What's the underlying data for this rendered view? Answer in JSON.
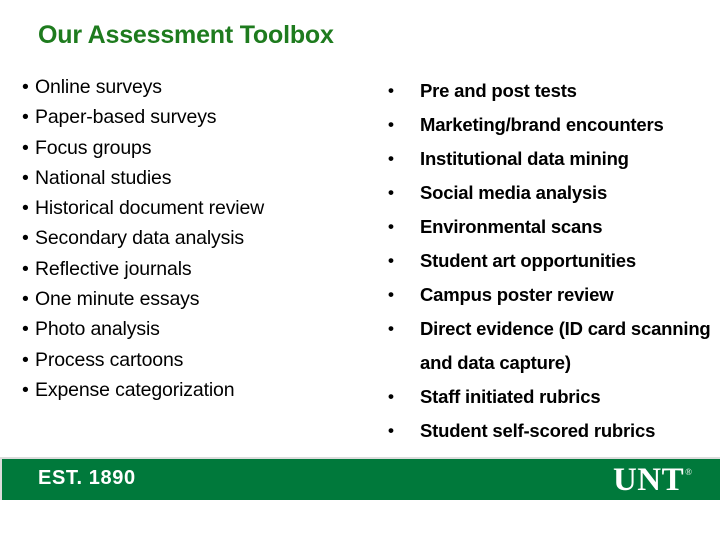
{
  "slide": {
    "title": "Our Assessment Toolbox",
    "title_color": "#1e7b1e",
    "background_color": "#ffffff"
  },
  "left_column": {
    "bullet_char": "•",
    "items": [
      {
        "label": "Online surveys"
      },
      {
        "label": "Paper-based surveys"
      },
      {
        "label": "Focus groups"
      },
      {
        "label": "National studies"
      },
      {
        "label": "Historical document review"
      },
      {
        "label": "Secondary data analysis"
      },
      {
        "label": "Reflective journals"
      },
      {
        "label": "One minute essays"
      },
      {
        "label": "Photo analysis"
      },
      {
        "label": "Process cartoons"
      },
      {
        "label": "Expense categorization"
      }
    ]
  },
  "right_column": {
    "bullet_char": "•",
    "items": [
      {
        "label": "Pre and post tests"
      },
      {
        "label": "Marketing/brand encounters"
      },
      {
        "label": "Institutional data mining"
      },
      {
        "label": "Social media analysis"
      },
      {
        "label": "Environmental scans"
      },
      {
        "label": "Student art opportunities"
      },
      {
        "label": "Campus poster review"
      },
      {
        "label": "Direct evidence (ID card scanning and data capture)"
      },
      {
        "label": "Staff initiated rubrics"
      },
      {
        "label": "Student self-scored rubrics"
      }
    ]
  },
  "footer": {
    "established_text": "EST. 1890",
    "logo_word": "UNT",
    "logo_trademark": "®",
    "bar_color": "#00793b",
    "text_color": "#ffffff"
  }
}
